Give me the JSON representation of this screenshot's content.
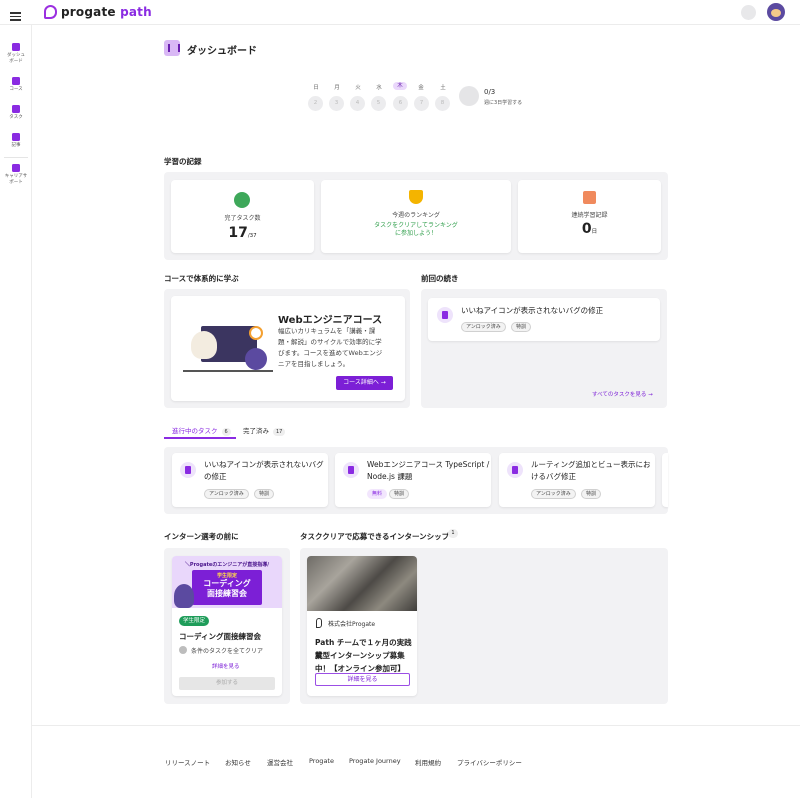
{
  "app": {
    "logo_main": "progate",
    "logo_accent": " path"
  },
  "sidebar": [
    {
      "label": "ダッシュボード",
      "icon": "dashboard-icon"
    },
    {
      "label": "コース",
      "icon": "flag-icon"
    },
    {
      "label": "タスク",
      "icon": "task-icon"
    },
    {
      "label": "記事",
      "icon": "article-icon"
    },
    {
      "label": "キャリアサポート",
      "icon": "briefcase-icon"
    }
  ],
  "page": {
    "title": "ダッシュボード"
  },
  "week": {
    "days": [
      {
        "label": "日",
        "num": "2"
      },
      {
        "label": "月",
        "num": "3"
      },
      {
        "label": "火",
        "num": "4"
      },
      {
        "label": "水",
        "num": "5"
      },
      {
        "label": "木",
        "num": "6",
        "today": true
      },
      {
        "label": "金",
        "num": "7"
      },
      {
        "label": "土",
        "num": "8"
      }
    ],
    "count": "0/3",
    "goal": "週に3日学習する"
  },
  "records": {
    "title": "学習の記録",
    "completed_label": "完了タスク数",
    "completed_value": "17",
    "completed_total": "/37",
    "ranking_label": "今週のランキング",
    "ranking_note_1": "タスクをクリアしてランキング",
    "ranking_note_2": "に参加しよう！",
    "streak_label": "連続学習記録",
    "streak_value": "0",
    "streak_unit": "日"
  },
  "course": {
    "section_title": "コースで体系的に学ぶ",
    "name": "Webエンジニアコース",
    "desc_1": "幅広いカリキュラムを「講義・課",
    "desc_2": "題・解説」のサイクルで効率的に学",
    "desc_3": "びます。コースを進めてWebエンジ",
    "desc_4": "ニアを目指しましょう。",
    "button": "コース詳細へ"
  },
  "continue": {
    "section_title": "前回の続き",
    "task": "いいねアイコンが表示されないバグの修正",
    "tags": [
      "アンロック済み",
      "特訓"
    ],
    "link": "すべてのタスクを見る"
  },
  "tabs": {
    "in_progress": "進行中のタスク",
    "in_progress_count": "6",
    "done": "完了済み",
    "done_count": "17"
  },
  "tasks": [
    {
      "line1": "いいねアイコンが表示されないバグ",
      "line2": "の修正",
      "tags": [
        "アンロック済み",
        "特訓"
      ]
    },
    {
      "line1": "Webエンジニアコース TypeScript /",
      "line2": "Node.js 課題",
      "tags": [
        "無料",
        "特訓"
      ]
    },
    {
      "line1": "ルーティング追加とビュー表示にお",
      "line2": "けるバグ修正",
      "tags": [
        "アンロック済み",
        "特訓"
      ]
    }
  ],
  "pre_intern": {
    "section_title": "インターン選考の前に",
    "banner_top": "＼Progateのエンジニアが直接指導/",
    "banner_small": "学生限定",
    "banner_line1": "コーディング",
    "banner_line2": "面接練習会",
    "badge": "学生限定",
    "title": "コーディング面接練習会",
    "condition": "条件のタスクを全てクリア",
    "detail_link": "詳細を見る",
    "apply_button": "参加する"
  },
  "intern": {
    "section_title": "タスククリアで応募できるインターンシップ",
    "count": "1",
    "company": "株式会社Progate",
    "title_1": "Path チームで１ヶ月の実践就",
    "title_2": "業型インターンシップ募集",
    "title_3": "中！【オンライン参加可】",
    "button": "詳細を見る"
  },
  "footer": [
    "リリースノート",
    "お知らせ",
    "運営会社",
    "Progate",
    "Progate Journey",
    "利用規約",
    "プライバシーポリシー"
  ],
  "colors": {
    "accent": "#8a2be2",
    "green": "#2e9e4a"
  }
}
